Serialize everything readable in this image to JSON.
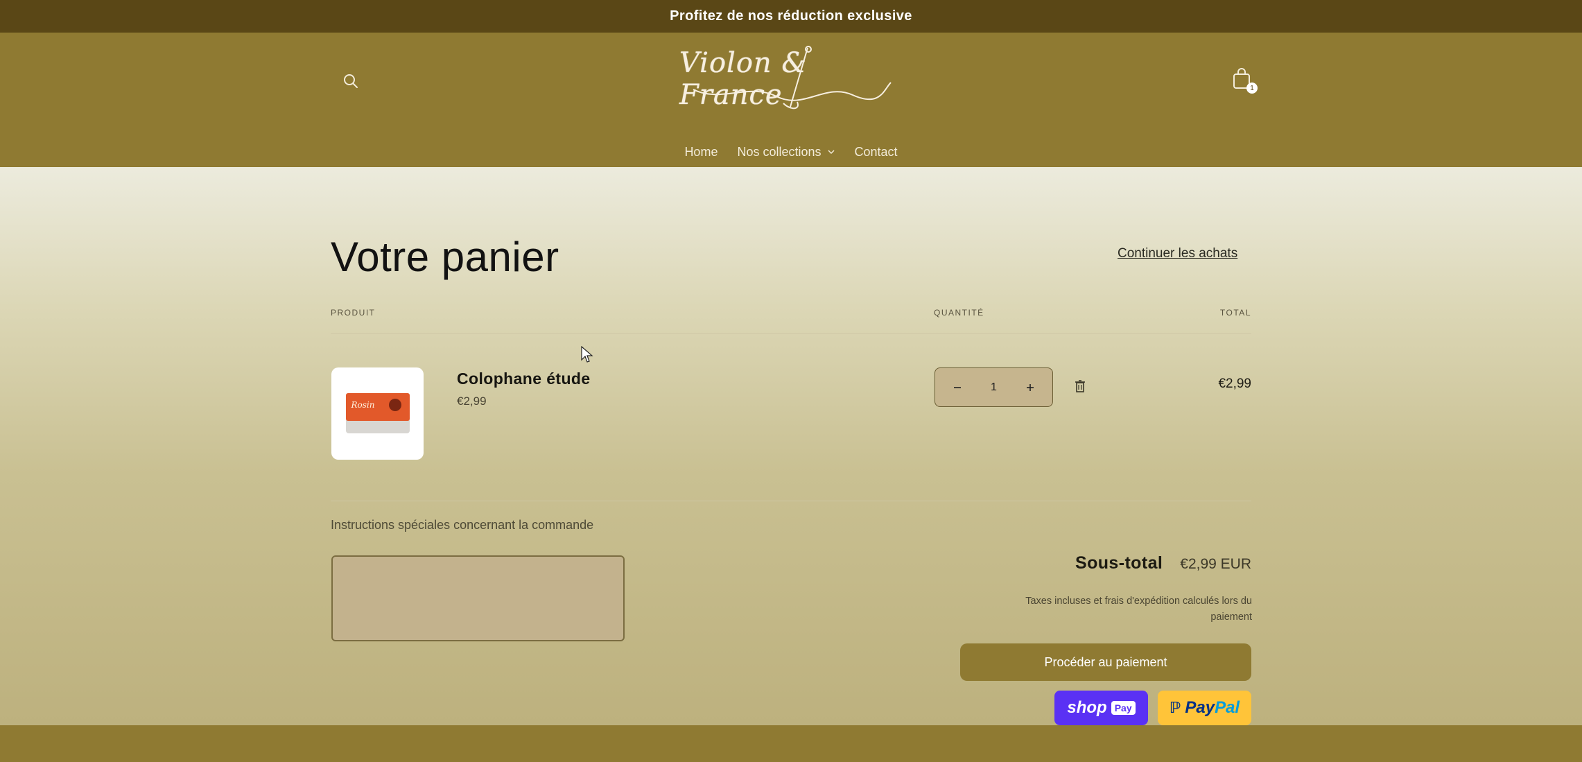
{
  "announcement": {
    "text": "Profitez de nos réduction exclusive"
  },
  "header": {
    "logo_text": "Violon & France",
    "cart_count": "1",
    "icons": {
      "search": "search-icon",
      "cart": "shopping-bag-icon"
    }
  },
  "nav": {
    "items": [
      {
        "label": "Home"
      },
      {
        "label": "Nos collections",
        "has_dropdown": true
      },
      {
        "label": "Contact"
      }
    ]
  },
  "cart": {
    "title": "Votre panier",
    "continue_label": "Continuer les achats",
    "columns": {
      "product": "PRODUIT",
      "quantity": "QUANTITÉ",
      "total": "TOTAL"
    },
    "items": [
      {
        "name": "Colophane étude",
        "price": "€2,99",
        "quantity": "1",
        "line_total": "€2,99"
      }
    ],
    "instructions_label": "Instructions spéciales concernant la commande",
    "subtotal_label": "Sous-total",
    "subtotal_value": "€2,99 EUR",
    "tax_note": "Taxes incluses et frais d'expédition calculés lors du paiement",
    "checkout_label": "Procéder au paiement",
    "shop_pay_label": "shop",
    "shop_pay_chip": "Pay",
    "paypal_label_1": "Pay",
    "paypal_label_2": "Pal"
  },
  "colors": {
    "header_bg": "#8f7a32",
    "announcement_bg": "#5a4716",
    "shop_pay": "#5a31f4",
    "paypal": "#ffc439"
  }
}
